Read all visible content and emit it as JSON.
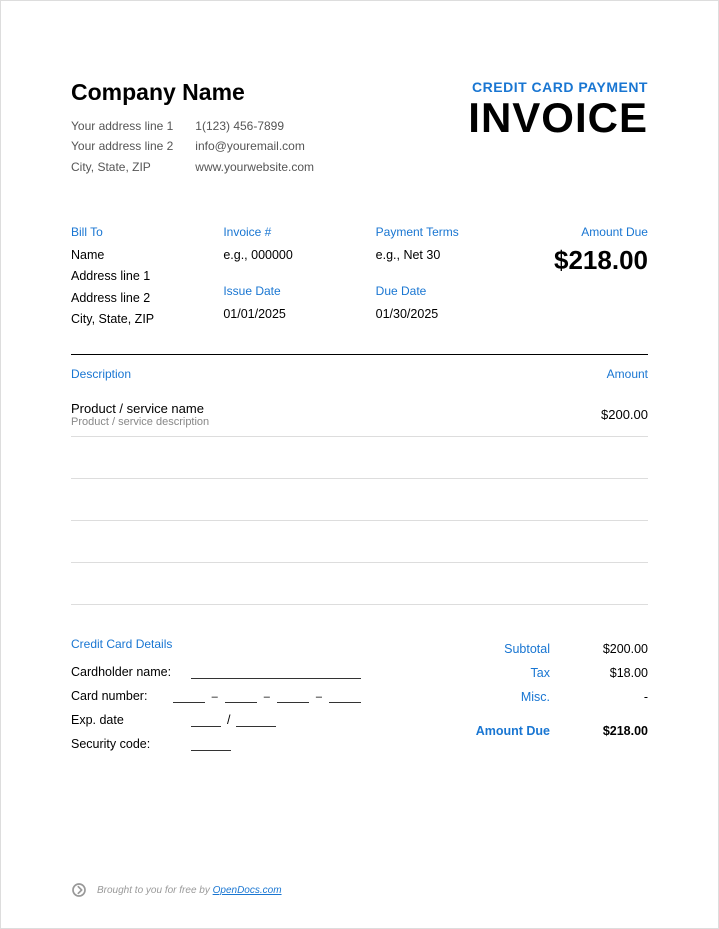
{
  "company": {
    "name": "Company Name",
    "address1": "Your address line 1",
    "address2": "Your address line 2",
    "city_state_zip": "City, State, ZIP",
    "phone": "1(123) 456-7899",
    "email": "info@youremail.com",
    "website": "www.yourwebsite.com"
  },
  "header": {
    "payment_type": "CREDIT CARD PAYMENT",
    "title": "INVOICE"
  },
  "labels": {
    "bill_to": "Bill To",
    "invoice_no": "Invoice #",
    "payment_terms": "Payment Terms",
    "amount_due": "Amount Due",
    "issue_date": "Issue Date",
    "due_date": "Due Date",
    "description": "Description",
    "amount": "Amount",
    "cc_section": "Credit Card Details",
    "cardholder": "Cardholder name:",
    "card_number": "Card number:",
    "exp_date": "Exp. date",
    "security_code": "Security code:",
    "subtotal": "Subtotal",
    "tax": "Tax",
    "misc": "Misc.",
    "amount_due_2": "Amount Due",
    "sep_slash": "/",
    "sep_dash": "–"
  },
  "bill_to": {
    "name": "Name",
    "address1": "Address line 1",
    "address2": "Address line 2",
    "city_state_zip": "City, State, ZIP"
  },
  "invoice": {
    "number": "e.g., 000000",
    "payment_terms": "e.g., Net 30",
    "issue_date": "01/01/2025",
    "due_date": "01/30/2025",
    "amount_due": "$218.00"
  },
  "items": [
    {
      "name": "Product / service name",
      "desc": "Product / service description",
      "amount": "$200.00"
    }
  ],
  "totals": {
    "subtotal": "$200.00",
    "tax": "$18.00",
    "misc": "-",
    "due": "$218.00"
  },
  "footer": {
    "text": "Brought to you for free by ",
    "link": "OpenDocs.com"
  }
}
